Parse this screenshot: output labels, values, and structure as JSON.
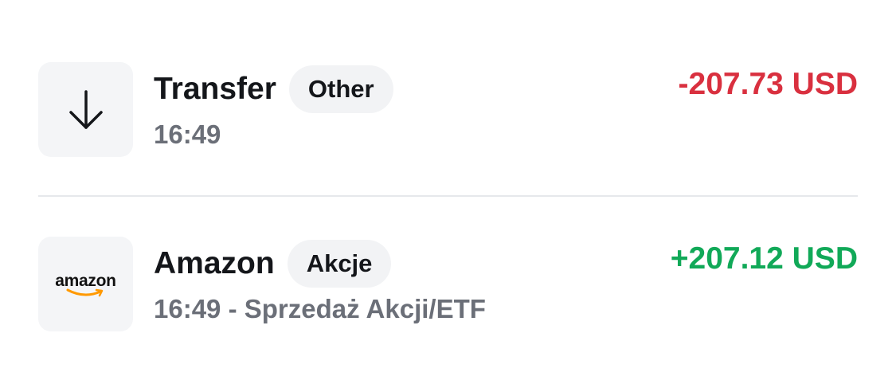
{
  "transactions": [
    {
      "icon": "arrow-down-icon",
      "title": "Transfer",
      "category": "Other",
      "subtitle": "16:49",
      "amount": "-207.73 USD",
      "direction": "negative"
    },
    {
      "icon": "amazon-logo",
      "logo_text": "amazon",
      "title": "Amazon",
      "category": "Akcje",
      "subtitle": "16:49 - Sprzedaż Akcji/ETF",
      "amount": "+207.12 USD",
      "direction": "positive"
    }
  ],
  "colors": {
    "negative": "#d9303f",
    "positive": "#11a958",
    "amazon_smile": "#ff9900"
  }
}
